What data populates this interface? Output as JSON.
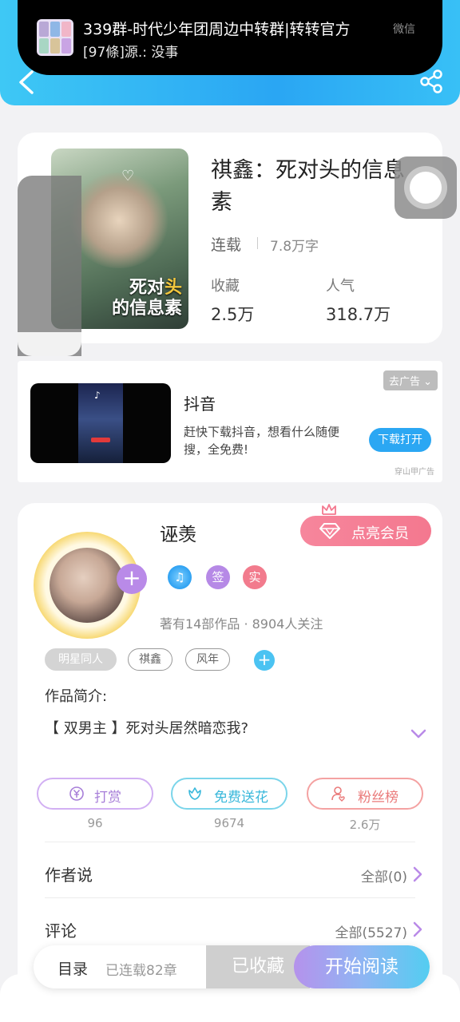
{
  "notification": {
    "title": "339群-时代少年团周边中转群|转转官方",
    "subtitle": "[97條]源.: 没事",
    "source": "微信"
  },
  "header": {
    "back_icon": "back-arrow-icon",
    "share_icon": "share-icon"
  },
  "book": {
    "title": "祺鑫：死对头的信息素",
    "cover_text_line1_a": "死对",
    "cover_text_line1_b": "头",
    "cover_text_line2": "的信息素",
    "status": "连载",
    "words": "7.8万字",
    "favorites_label": "收藏",
    "favorites_value": "2.5万",
    "popularity_label": "人气",
    "popularity_value": "318.7万"
  },
  "ad": {
    "title": "抖音",
    "description": "赶快下载抖音，想看什么随便搜，全免费!",
    "close_label": "去广告 ⌄",
    "cta_label": "下载打开",
    "source": "穿山甲广告"
  },
  "author": {
    "name": "诬羡",
    "vip_label": "点亮会员",
    "follow_symbol": "+",
    "badges": {
      "sign": "签",
      "real": "实",
      "music": "♫"
    },
    "stats": "著有14部作品 · 8904人关注",
    "tags": [
      "明星同人",
      "祺鑫",
      "风年"
    ],
    "tag_add": "+",
    "intro_label": "作品简介:",
    "intro_text": "【 双男主 】死对头居然暗恋我?"
  },
  "actions": [
    {
      "label": "打赏",
      "count": "96",
      "icon": "yen-coin-icon"
    },
    {
      "label": "免费送花",
      "count": "9674",
      "icon": "flower-icon"
    },
    {
      "label": "粉丝榜",
      "count": "2.6万",
      "icon": "fans-user-icon"
    }
  ],
  "rows": {
    "author_says_label": "作者说",
    "author_says_value": "全部(0)",
    "comments_label": "评论",
    "comments_value": "全部(5527)"
  },
  "bottom_bar": {
    "toc_label": "目录",
    "toc_count": "已连载82章",
    "collected_label": "已收藏",
    "read_label": "开始阅读"
  }
}
